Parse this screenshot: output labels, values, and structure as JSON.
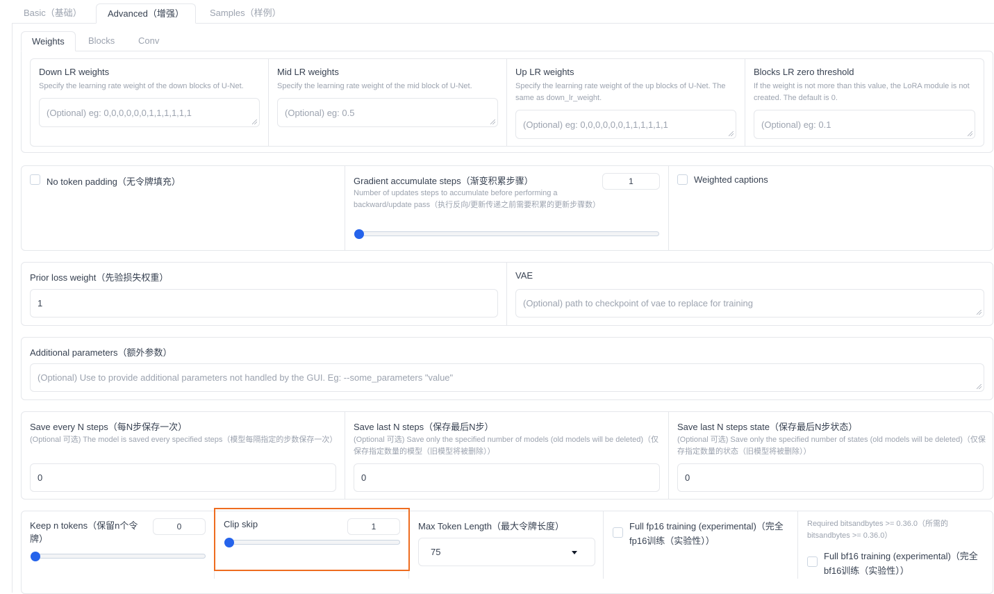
{
  "tabs": [
    {
      "label": "Basic（基础）"
    },
    {
      "label": "Advanced（增强）"
    },
    {
      "label": "Samples（样例）"
    }
  ],
  "subtabs": [
    {
      "label": "Weights"
    },
    {
      "label": "Blocks"
    },
    {
      "label": "Conv"
    }
  ],
  "weights": {
    "down": {
      "label": "Down LR weights",
      "info": "Specify the learning rate weight of the down blocks of U-Net.",
      "placeholder": "(Optional) eg: 0,0,0,0,0,0,1,1,1,1,1,1"
    },
    "mid": {
      "label": "Mid LR weights",
      "info": "Specify the learning rate weight of the mid block of U-Net.",
      "placeholder": "(Optional) eg: 0.5"
    },
    "up": {
      "label": "Up LR weights",
      "info": "Specify the learning rate weight of the up blocks of U-Net. The same as down_lr_weight.",
      "placeholder": "(Optional) eg: 0,0,0,0,0,0,1,1,1,1,1,1"
    },
    "zero": {
      "label": "Blocks LR zero threshold",
      "info": "If the weight is not more than this value, the LoRA module is not created. The default is 0.",
      "placeholder": "(Optional) eg: 0.1"
    }
  },
  "no_token_padding": {
    "label": "No token padding（无令牌填充）"
  },
  "grad_accum": {
    "label": "Gradient accumulate steps（渐变积累步骤）",
    "info": "Number of updates steps to accumulate before performing a backward/update pass（执行反向/更新传递之前需要积累的更新步骤数）",
    "value": "1",
    "slider_fraction": 0
  },
  "weighted_captions": {
    "label": "Weighted captions"
  },
  "prior_loss": {
    "label": "Prior loss weight（先验损失权重）",
    "value": "1"
  },
  "vae": {
    "label": "VAE",
    "placeholder": "(Optional) path to checkpoint of vae to replace for training"
  },
  "additional": {
    "label": "Additional parameters（额外参数）",
    "placeholder": "(Optional) Use to provide additional parameters not handled by the GUI. Eg: --some_parameters \"value\""
  },
  "save_every": {
    "label": "Save every N steps（每N步保存一次）",
    "info": "(Optional 可选) The model is saved every specified steps（模型每隔指定的步数保存一次）",
    "value": "0"
  },
  "save_last": {
    "label": "Save last N steps（保存最后N步）",
    "info": "(Optional 可选) Save only the specified number of models (old models will be deleted)（仅保存指定数量的模型（旧模型将被删除））",
    "value": "0"
  },
  "save_last_state": {
    "label": "Save last N steps state（保存最后N步状态）",
    "info": "(Optional 可选) Save only the specified number of states (old models will be deleted)（仅保存指定数量的状态（旧模型将被删除））",
    "value": "0"
  },
  "keep_tokens": {
    "label": "Keep n tokens（保留n个令牌）",
    "value": "0",
    "slider_fraction": 0
  },
  "clip_skip": {
    "label": "Clip skip",
    "value": "1",
    "slider_fraction": 0
  },
  "max_token": {
    "label": "Max Token Length（最大令牌长度）",
    "value": "75"
  },
  "fp16": {
    "label": "Full fp16 training (experimental)（完全fp16训练（实验性））"
  },
  "bf16": {
    "info": "Required bitsandbytes >= 0.36.0（所需的bitsandbytes >= 0.36.0）",
    "label": "Full bf16 training (experimental)（完全bf16训练（实验性））"
  },
  "colors": {
    "accent": "#2563eb",
    "highlight": "#ee6c1f",
    "border": "#e5e7eb",
    "muted": "#9ca3af"
  }
}
